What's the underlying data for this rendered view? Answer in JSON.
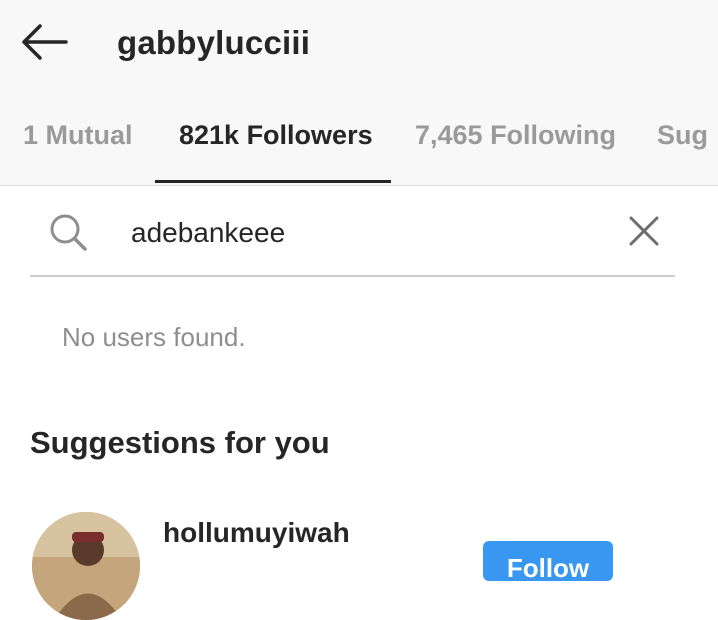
{
  "header": {
    "title": "gabbylucciii",
    "back_icon": "arrow-left-icon"
  },
  "tabs": [
    {
      "label": "1 Mutual",
      "active": false
    },
    {
      "label": "821k Followers",
      "active": true
    },
    {
      "label": "7,465 Following",
      "active": false
    },
    {
      "label": "Sug",
      "active": false
    }
  ],
  "search": {
    "value": "adebankeee",
    "search_icon": "search-icon",
    "clear_icon": "close-icon"
  },
  "results": {
    "empty_message": "No users found."
  },
  "suggestions": {
    "heading": "Suggestions for you",
    "items": [
      {
        "username": "hollumuyiwah",
        "button_label": "Follow"
      }
    ]
  },
  "colors": {
    "header_bg": "#f8f8f8",
    "text_primary": "#262626",
    "text_muted": "#9a9a9a",
    "follow_button": "#3897f0"
  }
}
